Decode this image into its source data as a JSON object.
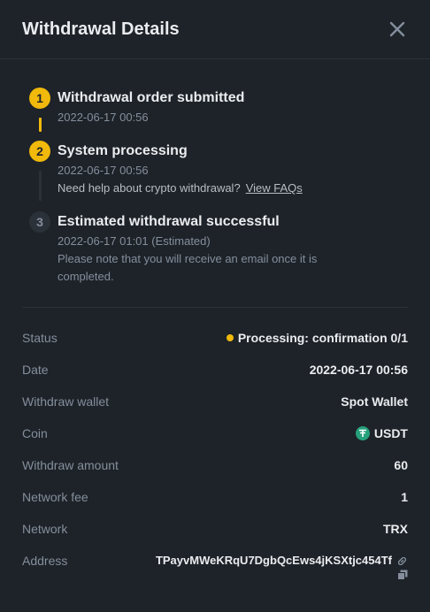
{
  "header": {
    "title": "Withdrawal Details"
  },
  "steps": [
    {
      "number": "1",
      "title": "Withdrawal order submitted",
      "time": "2022-06-17 00:56"
    },
    {
      "number": "2",
      "title": "System processing",
      "time": "2022-06-17 00:56",
      "help_text": "Need help about crypto withdrawal?",
      "link_text": "View FAQs"
    },
    {
      "number": "3",
      "title": "Estimated withdrawal successful",
      "time": "2022-06-17 01:01 (Estimated)",
      "note": "Please note that you will receive an email once it is completed."
    }
  ],
  "details": {
    "status": {
      "label": "Status",
      "value": "Processing: confirmation 0/1"
    },
    "date": {
      "label": "Date",
      "value": "2022-06-17 00:56"
    },
    "wallet": {
      "label": "Withdraw wallet",
      "value": "Spot Wallet"
    },
    "coin": {
      "label": "Coin",
      "value": "USDT"
    },
    "amount": {
      "label": "Withdraw amount",
      "value": "60"
    },
    "fee": {
      "label": "Network fee",
      "value": "1"
    },
    "network": {
      "label": "Network",
      "value": "TRX"
    },
    "address": {
      "label": "Address",
      "value": "TPayvMWeKRqU7DgbQcEws4jKSXtjc454Tf"
    }
  },
  "colors": {
    "accent": "#f0b90b",
    "background": "#1e2329",
    "muted": "#848e9c",
    "tether": "#26a17b"
  },
  "icons": {
    "close": "close-icon",
    "link": "link-icon",
    "copy": "copy-icon",
    "coin": "tether-icon"
  }
}
